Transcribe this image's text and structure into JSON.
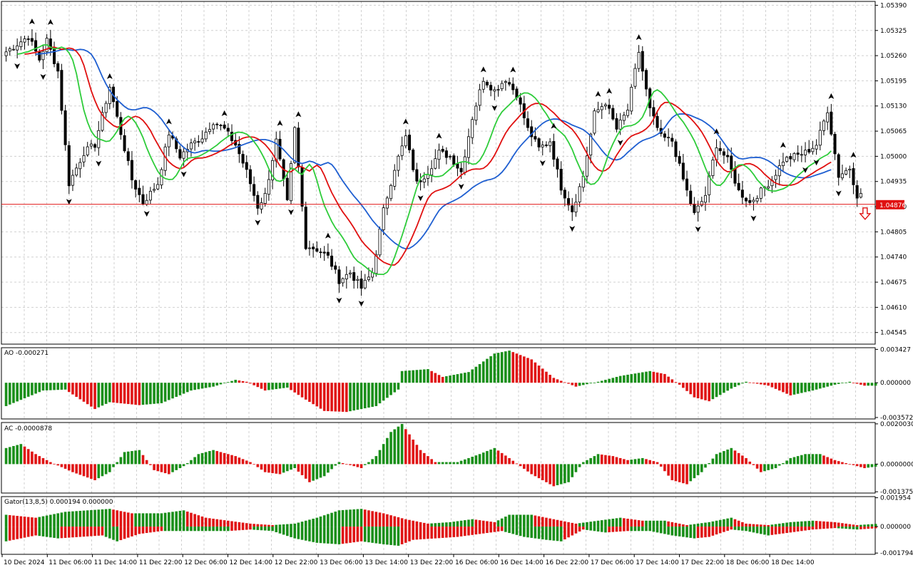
{
  "colors": {
    "bull_candle": "#ffffff",
    "bear_candle": "#000000",
    "jaw": "#1f5fd1",
    "teeth": "#e01010",
    "lips": "#2ecc3a",
    "hist_up": "#1a8f1a",
    "hist_down": "#e01515",
    "price_line": "#e01010",
    "fractal": "#000000",
    "sell_arrow": "#e01010",
    "grid": "#d0d0d0"
  },
  "chart_data": [
    {
      "type": "candlestick",
      "panel": "main",
      "y_ticks": [
        "1.05390",
        "1.05325",
        "1.05260",
        "1.05195",
        "1.05130",
        "1.05065",
        "1.05000",
        "1.04935",
        "1.04870",
        "1.04805",
        "1.04740",
        "1.04675",
        "1.04610",
        "1.04545"
      ],
      "ylim": [
        1.04515,
        1.054
      ],
      "current_price": "1.04876",
      "current_price_value": 1.04876,
      "x_labels": [
        "10 Dec 2024",
        "11 Dec 06:00",
        "11 Dec 14:00",
        "11 Dec 22:00",
        "12 Dec 06:00",
        "12 Dec 14:00",
        "12 Dec 22:00",
        "13 Dec 06:00",
        "13 Dec 14:00",
        "13 Dec 22:00",
        "16 Dec 06:00",
        "16 Dec 14:00",
        "16 Dec 22:00",
        "17 Dec 06:00",
        "17 Dec 14:00",
        "17 Dec 22:00",
        "18 Dec 06:00",
        "18 Dec 14:00"
      ],
      "close_anchors": [
        [
          0,
          1.0527
        ],
        [
          3,
          1.0529
        ],
        [
          6,
          1.0531
        ],
        [
          9,
          1.0525
        ],
        [
          11,
          1.053
        ],
        [
          14,
          1.0522
        ],
        [
          17,
          1.0493
        ],
        [
          21,
          1.0501
        ],
        [
          24,
          1.0503
        ],
        [
          28,
          1.0518
        ],
        [
          30,
          1.051
        ],
        [
          34,
          1.0494
        ],
        [
          37,
          1.0488
        ],
        [
          41,
          1.0493
        ],
        [
          44,
          1.0506
        ],
        [
          47,
          1.05
        ],
        [
          50,
          1.0503
        ],
        [
          53,
          1.0505
        ],
        [
          56,
          1.0509
        ],
        [
          59,
          1.0507
        ],
        [
          62,
          1.0503
        ],
        [
          65,
          1.0496
        ],
        [
          68,
          1.0487
        ],
        [
          70,
          1.049
        ],
        [
          73,
          1.0504
        ],
        [
          76,
          1.0488
        ],
        [
          78,
          1.0507
        ],
        [
          81,
          1.0477
        ],
        [
          84,
          1.0476
        ],
        [
          87,
          1.0474
        ],
        [
          90,
          1.0468
        ],
        [
          93,
          1.047
        ],
        [
          96,
          1.0466
        ],
        [
          99,
          1.047
        ],
        [
          102,
          1.0486
        ],
        [
          105,
          1.0497
        ],
        [
          108,
          1.0505
        ],
        [
          111,
          1.0493
        ],
        [
          114,
          1.0496
        ],
        [
          117,
          1.0501
        ],
        [
          120,
          1.05
        ],
        [
          123,
          1.0496
        ],
        [
          126,
          1.051
        ],
        [
          129,
          1.052
        ],
        [
          132,
          1.0517
        ],
        [
          135,
          1.052
        ],
        [
          138,
          1.0516
        ],
        [
          141,
          1.0507
        ],
        [
          144,
          1.0502
        ],
        [
          147,
          1.0504
        ],
        [
          150,
          1.0492
        ],
        [
          153,
          1.0486
        ],
        [
          156,
          1.0495
        ],
        [
          159,
          1.0511
        ],
        [
          162,
          1.0514
        ],
        [
          165,
          1.0507
        ],
        [
          168,
          1.0512
        ],
        [
          171,
          1.0527
        ],
        [
          174,
          1.0512
        ],
        [
          177,
          1.0505
        ],
        [
          180,
          1.0504
        ],
        [
          183,
          1.0494
        ],
        [
          186,
          1.0485
        ],
        [
          189,
          1.049
        ],
        [
          192,
          1.0503
        ],
        [
          195,
          1.0499
        ],
        [
          198,
          1.0491
        ],
        [
          201,
          1.0488
        ],
        [
          204,
          1.0491
        ],
        [
          207,
          1.0494
        ],
        [
          210,
          1.0499
        ],
        [
          213,
          1.05
        ],
        [
          216,
          1.0501
        ],
        [
          219,
          1.0503
        ],
        [
          222,
          1.0512
        ],
        [
          225,
          1.0495
        ],
        [
          228,
          1.0497
        ],
        [
          230,
          1.049
        ]
      ],
      "sell_arrow_bar": 231
    },
    {
      "type": "bar",
      "panel": "AO",
      "label": "AO -0.000271",
      "y_ticks": [
        "0.003427",
        "0.000000",
        "-0.003572"
      ],
      "ylim": [
        -0.00372,
        0.0036
      ],
      "anchors": [
        [
          0,
          -0.0024
        ],
        [
          10,
          -0.0008
        ],
        [
          16,
          -0.0007
        ],
        [
          24,
          -0.0027
        ],
        [
          28,
          -0.002
        ],
        [
          36,
          -0.0023
        ],
        [
          42,
          -0.0021
        ],
        [
          50,
          -0.0008
        ],
        [
          56,
          -0.0004
        ],
        [
          62,
          0.0003
        ],
        [
          65,
          0.0001
        ],
        [
          70,
          -0.0008
        ],
        [
          76,
          -0.0005
        ],
        [
          80,
          -0.0015
        ],
        [
          86,
          -0.0029
        ],
        [
          92,
          -0.003
        ],
        [
          100,
          -0.0024
        ],
        [
          106,
          -0.0007
        ],
        [
          107,
          0.0012
        ],
        [
          114,
          0.0014
        ],
        [
          118,
          0.0006
        ],
        [
          125,
          0.0011
        ],
        [
          132,
          0.003
        ],
        [
          136,
          0.0033
        ],
        [
          142,
          0.0024
        ],
        [
          148,
          0.0005
        ],
        [
          154,
          -0.0004
        ],
        [
          160,
          0.0001
        ],
        [
          166,
          0.0007
        ],
        [
          174,
          0.0012
        ],
        [
          178,
          0.0009
        ],
        [
          182,
          -0.0002
        ],
        [
          186,
          -0.0015
        ],
        [
          190,
          -0.0019
        ],
        [
          196,
          -0.0006
        ],
        [
          200,
          0.0001
        ],
        [
          206,
          -0.0003
        ],
        [
          212,
          -0.0013
        ],
        [
          218,
          -0.0008
        ],
        [
          224,
          -0.0002
        ],
        [
          228,
          0.0001
        ],
        [
          232,
          -0.0003
        ],
        [
          236,
          -0.0003
        ]
      ]
    },
    {
      "type": "bar",
      "panel": "AC",
      "label": "AC -0.0000878",
      "y_ticks": [
        "0.0020030",
        "0.0000000",
        "-0.0013755"
      ],
      "ylim": [
        -0.00144,
        0.00207
      ],
      "anchors": [
        [
          0,
          0.0008
        ],
        [
          4,
          0.001
        ],
        [
          8,
          0.0005
        ],
        [
          12,
          0.0001
        ],
        [
          18,
          -0.0004
        ],
        [
          24,
          -0.0008
        ],
        [
          28,
          -0.0004
        ],
        [
          32,
          0.0006
        ],
        [
          36,
          0.0007
        ],
        [
          40,
          -0.0003
        ],
        [
          44,
          -0.0005
        ],
        [
          48,
          -0.0001
        ],
        [
          52,
          0.0005
        ],
        [
          56,
          0.0007
        ],
        [
          62,
          0.0004
        ],
        [
          66,
          0.0001
        ],
        [
          70,
          -0.0004
        ],
        [
          74,
          -0.0005
        ],
        [
          78,
          -0.0002
        ],
        [
          82,
          -0.0009
        ],
        [
          86,
          -0.0006
        ],
        [
          90,
          0.0001
        ],
        [
          96,
          -0.0002
        ],
        [
          100,
          0.0004
        ],
        [
          104,
          0.0016
        ],
        [
          107,
          0.002
        ],
        [
          112,
          0.0007
        ],
        [
          116,
          0.0001
        ],
        [
          122,
          0.0001
        ],
        [
          128,
          0.0005
        ],
        [
          132,
          0.0008
        ],
        [
          136,
          0.0003
        ],
        [
          142,
          -0.0005
        ],
        [
          148,
          -0.0011
        ],
        [
          152,
          -0.0009
        ],
        [
          156,
          0.0001
        ],
        [
          160,
          0.0005
        ],
        [
          164,
          0.0004
        ],
        [
          168,
          0.0002
        ],
        [
          172,
          0.0003
        ],
        [
          176,
          0.0001
        ],
        [
          180,
          -0.0008
        ],
        [
          184,
          -0.001
        ],
        [
          188,
          -0.0004
        ],
        [
          192,
          0.0005
        ],
        [
          196,
          0.0008
        ],
        [
          200,
          0.0003
        ],
        [
          204,
          -0.0004
        ],
        [
          208,
          -0.0002
        ],
        [
          212,
          0.0003
        ],
        [
          216,
          0.0005
        ],
        [
          220,
          0.0005
        ],
        [
          224,
          0.0002
        ],
        [
          228,
          0.0
        ],
        [
          232,
          -0.0002
        ],
        [
          236,
          -0.0001
        ]
      ]
    },
    {
      "type": "bar",
      "panel": "Gator",
      "label": "Gator(13,8,5) 0.000194 0.000000",
      "y_ticks": [
        "0.001954",
        "0.000000",
        "-0.001794"
      ],
      "ylim": [
        -0.00188,
        0.00203
      ],
      "upper_anchors": [
        [
          0,
          0.0008
        ],
        [
          8,
          0.0006
        ],
        [
          16,
          0.001
        ],
        [
          22,
          0.0011
        ],
        [
          28,
          0.0012
        ],
        [
          34,
          0.0009
        ],
        [
          42,
          0.0009
        ],
        [
          48,
          0.0011
        ],
        [
          54,
          0.0006
        ],
        [
          60,
          0.0004
        ],
        [
          66,
          0.0002
        ],
        [
          72,
          0.0001
        ],
        [
          78,
          0.0002
        ],
        [
          84,
          0.0006
        ],
        [
          90,
          0.0011
        ],
        [
          96,
          0.0012
        ],
        [
          102,
          0.0009
        ],
        [
          108,
          0.0005
        ],
        [
          114,
          0.0002
        ],
        [
          120,
          0.0003
        ],
        [
          126,
          0.0005
        ],
        [
          132,
          0.0003
        ],
        [
          136,
          0.0008
        ],
        [
          142,
          0.0008
        ],
        [
          148,
          0.0005
        ],
        [
          154,
          0.0002
        ],
        [
          160,
          0.0004
        ],
        [
          166,
          0.0006
        ],
        [
          172,
          0.0004
        ],
        [
          178,
          0.0004
        ],
        [
          184,
          0.0001
        ],
        [
          190,
          0.0003
        ],
        [
          196,
          0.0006
        ],
        [
          200,
          0.0002
        ],
        [
          206,
          0.0001
        ],
        [
          212,
          0.0003
        ],
        [
          218,
          0.0004
        ],
        [
          224,
          0.0003
        ],
        [
          230,
          0.0001
        ],
        [
          236,
          0.0002
        ]
      ],
      "lower_anchors": [
        [
          0,
          -0.001
        ],
        [
          8,
          -0.0006
        ],
        [
          14,
          -0.0008
        ],
        [
          20,
          -0.0007
        ],
        [
          26,
          -0.0006
        ],
        [
          30,
          -0.001
        ],
        [
          36,
          -0.0005
        ],
        [
          42,
          -0.0003
        ],
        [
          48,
          -0.0003
        ],
        [
          54,
          -0.0003
        ],
        [
          60,
          -0.0003
        ],
        [
          66,
          -0.0002
        ],
        [
          72,
          -0.0003
        ],
        [
          78,
          -0.0008
        ],
        [
          84,
          -0.0011
        ],
        [
          90,
          -0.0012
        ],
        [
          96,
          -0.001
        ],
        [
          102,
          -0.0012
        ],
        [
          106,
          -0.0013
        ],
        [
          110,
          -0.0009
        ],
        [
          116,
          -0.0008
        ],
        [
          122,
          -0.0007
        ],
        [
          128,
          -0.0005
        ],
        [
          134,
          -0.0003
        ],
        [
          140,
          -0.0007
        ],
        [
          146,
          -0.0009
        ],
        [
          150,
          -0.001
        ],
        [
          156,
          -0.0002
        ],
        [
          162,
          -0.0004
        ],
        [
          168,
          -0.0003
        ],
        [
          174,
          -0.0003
        ],
        [
          180,
          -0.0006
        ],
        [
          186,
          -0.0008
        ],
        [
          190,
          -0.0007
        ],
        [
          196,
          -0.0002
        ],
        [
          200,
          -0.0003
        ],
        [
          206,
          -0.0006
        ],
        [
          212,
          -0.0004
        ],
        [
          218,
          -0.0002
        ],
        [
          224,
          -0.0001
        ],
        [
          230,
          -0.0002
        ],
        [
          236,
          -0.0001
        ]
      ]
    }
  ]
}
